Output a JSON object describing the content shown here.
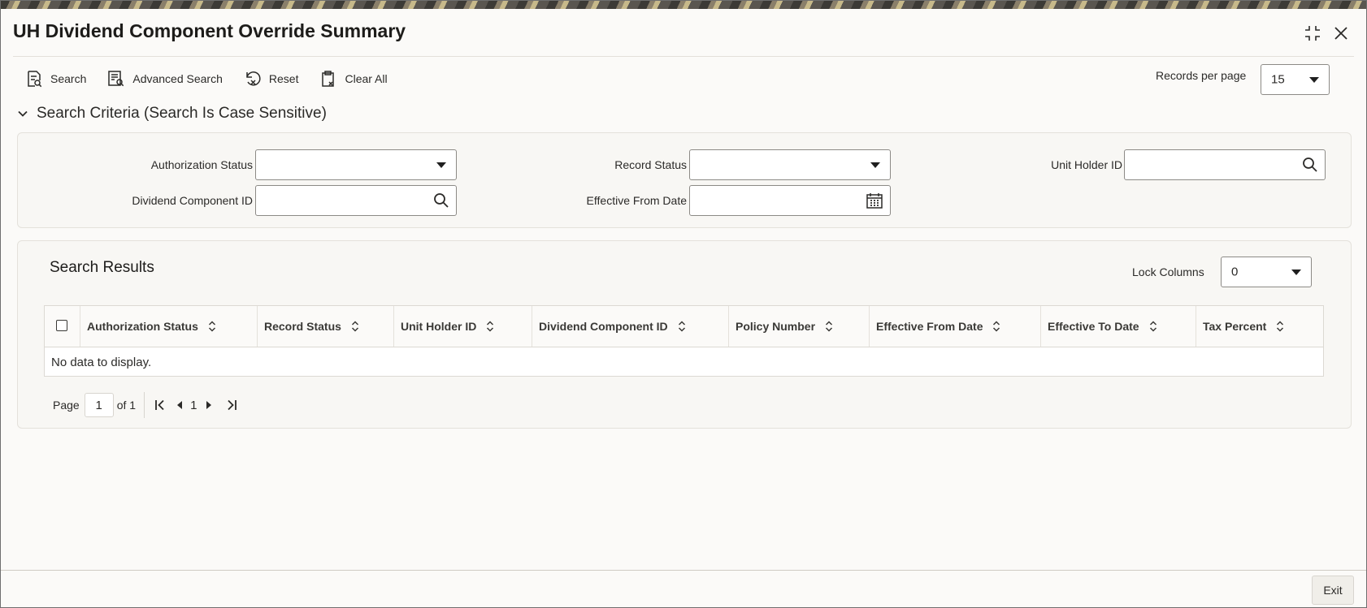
{
  "window": {
    "title": "UH Dividend Component Override Summary"
  },
  "toolbar": {
    "search": "Search",
    "advanced_search": "Advanced Search",
    "reset": "Reset",
    "clear_all": "Clear All",
    "records_per_page_label": "Records per page",
    "records_per_page_value": "15"
  },
  "criteria": {
    "heading": "Search Criteria (Search Is Case Sensitive)",
    "authorization_status_label": "Authorization Status",
    "authorization_status_value": "",
    "record_status_label": "Record Status",
    "record_status_value": "",
    "unit_holder_id_label": "Unit Holder ID",
    "unit_holder_id_value": "",
    "dividend_component_id_label": "Dividend Component ID",
    "dividend_component_id_value": "",
    "effective_from_date_label": "Effective From Date",
    "effective_from_date_value": ""
  },
  "results": {
    "title": "Search Results",
    "lock_columns_label": "Lock Columns",
    "lock_columns_value": "0",
    "columns": [
      "Authorization Status",
      "Record Status",
      "Unit Holder ID",
      "Dividend Component ID",
      "Policy Number",
      "Effective From Date",
      "Effective To Date",
      "Tax Percent"
    ],
    "empty_message": "No data to display."
  },
  "pagination": {
    "page_label": "Page",
    "current_page": "1",
    "of_label": "of 1",
    "page_number": "1"
  },
  "footer": {
    "exit": "Exit"
  }
}
